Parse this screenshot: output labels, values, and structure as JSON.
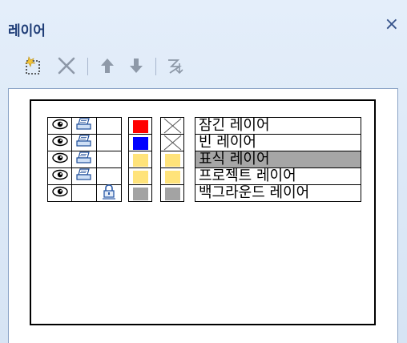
{
  "panel": {
    "title": "레이어",
    "close_icon": "×"
  },
  "toolbar": {
    "buttons": [
      {
        "name": "new-layer-icon"
      },
      {
        "name": "delete-layer-icon"
      },
      {
        "name": "move-up-icon"
      },
      {
        "name": "move-down-icon"
      },
      {
        "name": "layer-properties-icon"
      }
    ]
  },
  "layers": [
    {
      "name": "잠긴 레이어",
      "visible": true,
      "printable": true,
      "locked": false,
      "color": "#ff0000",
      "fill": "none",
      "selected": false
    },
    {
      "name": "빈 레이어",
      "visible": true,
      "printable": true,
      "locked": false,
      "color": "#0000ff",
      "fill": "none",
      "selected": false
    },
    {
      "name": "표식 레이어",
      "visible": true,
      "printable": true,
      "locked": false,
      "color": "#ffe37a",
      "fill": "#ffe37a",
      "selected": true
    },
    {
      "name": "프로젝트 레이어",
      "visible": true,
      "printable": true,
      "locked": false,
      "color": "#ffe37a",
      "fill": "#ffe37a",
      "selected": false
    },
    {
      "name": "백그라운드 레이어",
      "visible": true,
      "printable": false,
      "locked": true,
      "color": "#a3a3a3",
      "fill": "#a3a3a3",
      "selected": false
    }
  ],
  "colors": {
    "selected_row": "#a6a6a6",
    "title": "#1f3d77"
  }
}
